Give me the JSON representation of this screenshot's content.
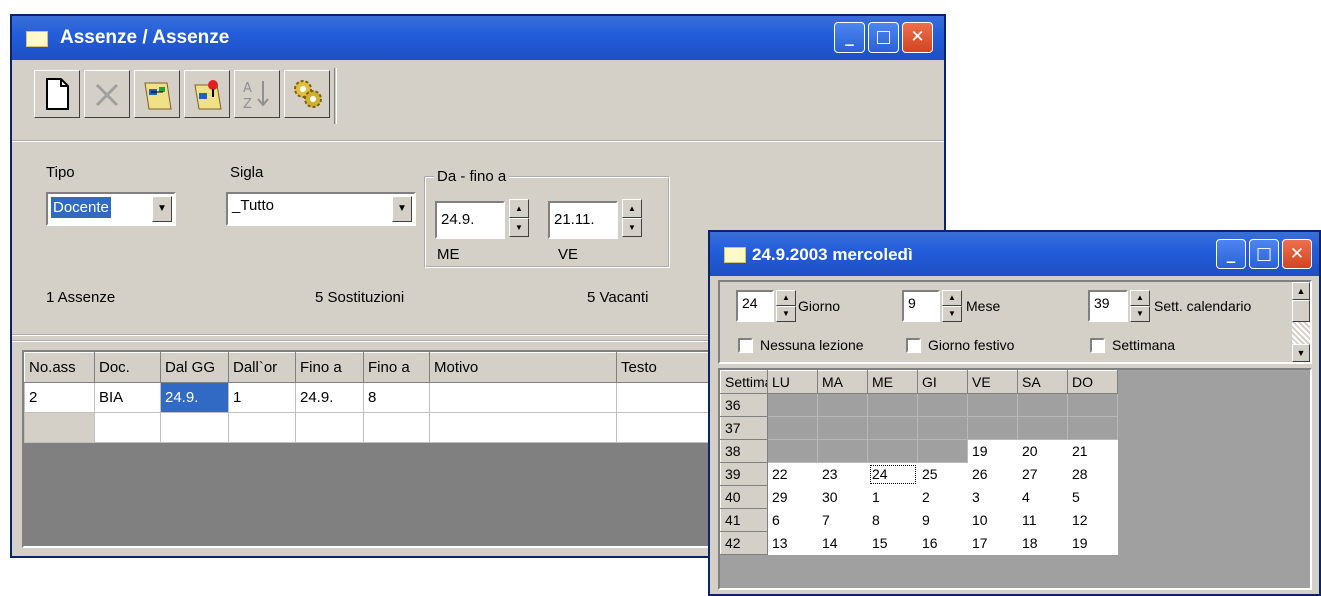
{
  "main_window": {
    "title": "Assenze / Assenze",
    "toolbar": [
      "new-document-icon",
      "delete-icon",
      "absence-icon",
      "absence-pin-icon",
      "sort-icon",
      "settings-icon"
    ],
    "filters": {
      "tipo_label": "Tipo",
      "tipo_value": "Docente",
      "sigla_label": "Sigla",
      "sigla_value": "_Tutto",
      "range_label": "Da - fino a",
      "from_value": "24.9.",
      "to_value": "21.11.",
      "from_day": "ME",
      "to_day": "VE"
    },
    "summary": {
      "assenze": "1 Assenze",
      "sostituzioni": "5 Sostituzioni",
      "vacanti": "5 Vacanti"
    },
    "table": {
      "columns": [
        "No.ass",
        "Doc.",
        "Dal GG",
        "Dall`or",
        "Fino a",
        "Fino a",
        "Motivo",
        "Testo"
      ],
      "rows": [
        [
          "2",
          "BIA",
          "24.9.",
          "1",
          "24.9.",
          "8",
          "",
          ""
        ],
        [
          "",
          "",
          "",
          "",
          "",
          "",
          "",
          ""
        ]
      ]
    }
  },
  "calendar_window": {
    "title": "24.9.2003 mercoledì",
    "giorno_value": "24",
    "giorno_label": "Giorno",
    "mese_value": "9",
    "mese_label": "Mese",
    "sett_value": "39",
    "sett_label": "Sett. calendario",
    "checkbox_nessuna": "Nessuna lezione",
    "checkbox_festivo": "Giorno festivo",
    "checkbox_settimana": "Settimana",
    "grid": {
      "week_header": "Settimana",
      "days": [
        "LU",
        "MA",
        "ME",
        "GI",
        "VE",
        "SA",
        "DO"
      ],
      "weeks": [
        {
          "week": "36",
          "days": [
            "",
            "",
            "",
            "",
            "",
            "",
            ""
          ]
        },
        {
          "week": "37",
          "days": [
            "",
            "",
            "",
            "",
            "",
            "",
            ""
          ]
        },
        {
          "week": "38",
          "days": [
            "",
            "",
            "",
            "",
            "19",
            "20",
            "21"
          ]
        },
        {
          "week": "39",
          "days": [
            "22",
            "23",
            "24",
            "25",
            "26",
            "27",
            "28"
          ]
        },
        {
          "week": "40",
          "days": [
            "29",
            "30",
            "1",
            "2",
            "3",
            "4",
            "5"
          ]
        },
        {
          "week": "41",
          "days": [
            "6",
            "7",
            "8",
            "9",
            "10",
            "11",
            "12"
          ]
        },
        {
          "week": "42",
          "days": [
            "13",
            "14",
            "15",
            "16",
            "17",
            "18",
            "19"
          ]
        }
      ],
      "selected": "24"
    }
  },
  "colors": {
    "titlebar": "#245edb",
    "face": "#d4d0c8",
    "selection": "#316ac5",
    "disabled_cell": "#a0a0a0"
  }
}
